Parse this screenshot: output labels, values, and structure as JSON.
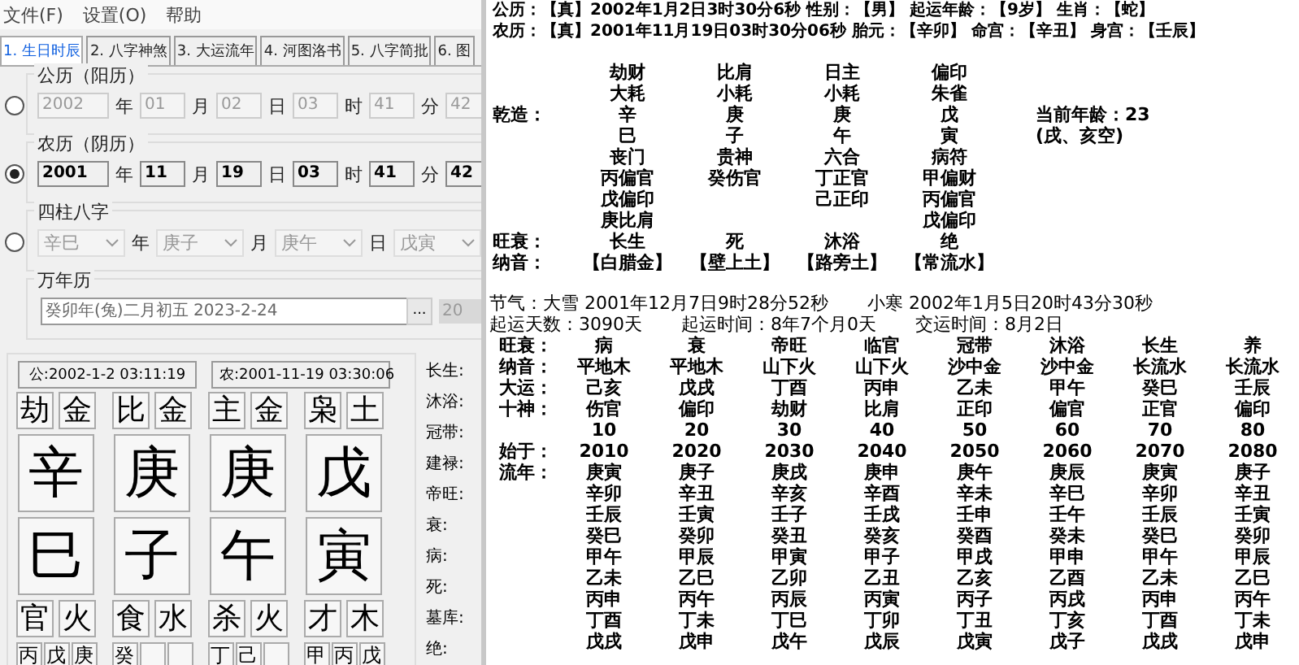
{
  "menu": [
    "文件(F)",
    "设置(O)",
    "帮助"
  ],
  "tabs": [
    {
      "label": "1. 生日时辰",
      "selected": true
    },
    {
      "label": "2. 八字神煞",
      "selected": false
    },
    {
      "label": "3. 大运流年",
      "selected": false
    },
    {
      "label": "4. 河图洛书",
      "selected": false
    },
    {
      "label": "5. 八字简批",
      "selected": false
    },
    {
      "label": "6. 图",
      "selected": false
    }
  ],
  "date_groups": [
    {
      "kind": "fields",
      "title": "公历（阳历）",
      "selected": false,
      "fields": [
        {
          "value": "2002",
          "unit": "年"
        },
        {
          "value": "01",
          "unit": "月"
        },
        {
          "value": "02",
          "unit": "日"
        },
        {
          "value": "03",
          "unit": "时"
        },
        {
          "value": "41",
          "unit": "分"
        },
        {
          "value": "42"
        }
      ]
    },
    {
      "kind": "fields",
      "title": "农历（阴历）",
      "selected": true,
      "fields": [
        {
          "value": "2001",
          "unit": "年"
        },
        {
          "value": "11",
          "unit": "月"
        },
        {
          "value": "19",
          "unit": "日"
        },
        {
          "value": "03",
          "unit": "时"
        },
        {
          "value": "41",
          "unit": "分"
        },
        {
          "value": "42"
        }
      ]
    },
    {
      "kind": "combos",
      "title": "四柱八字",
      "selected": false,
      "fields": [
        {
          "value": "辛巳",
          "unit": "年"
        },
        {
          "value": "庚子",
          "unit": "月"
        },
        {
          "value": "庚午",
          "unit": "日"
        },
        {
          "value": "戊寅"
        }
      ]
    }
  ],
  "calendar": {
    "title": "万年历",
    "value": "癸卯年(兔)二月初五  2023-2-24",
    "button": "...",
    "combo": "20"
  },
  "chart_card": {
    "solar_time": "公:2002-1-2 03:11:19",
    "lunar_time": "农:2001-11-19 03:30:06",
    "pillars": [
      {
        "top": [
          "劫",
          "金"
        ],
        "stem": "辛",
        "branch": "巳",
        "bottom": [
          "官",
          "火"
        ],
        "hidden": [
          "丙",
          "戊",
          "庚"
        ]
      },
      {
        "top": [
          "比",
          "金"
        ],
        "stem": "庚",
        "branch": "子",
        "bottom": [
          "食",
          "水"
        ],
        "hidden": [
          "癸"
        ]
      },
      {
        "top": [
          "主",
          "金"
        ],
        "stem": "庚",
        "branch": "午",
        "bottom": [
          "杀",
          "火"
        ],
        "hidden": [
          "丁",
          "己"
        ]
      },
      {
        "top": [
          "枭",
          "土"
        ],
        "stem": "戊",
        "branch": "寅",
        "bottom": [
          "才",
          "木"
        ],
        "hidden": [
          "甲",
          "丙",
          "戊"
        ]
      }
    ],
    "stages": [
      "长生:",
      "沐浴:",
      "冠带:",
      "建禄:",
      "帝旺:",
      "衰:",
      "病:",
      "死:",
      "墓库:",
      "绝:"
    ]
  },
  "report": {
    "header": [
      "公历：【真】2002年1月2日3时30分6秒  性别：【男】  起运年龄：【9岁】  生肖：【蛇】",
      "农历：【真】2001年11月19日03时30分06秒  胎元：【辛卯】  命宫：【辛丑】  身宫：【壬辰】"
    ],
    "chart_rows": [
      {
        "cells": [
          "劫财",
          "比肩",
          "日主",
          "偏印"
        ]
      },
      {
        "cells": [
          "大耗",
          "小耗",
          "小耗",
          "朱雀"
        ]
      },
      {
        "label": "乾造：",
        "cells": [
          "辛",
          "庚",
          "庚",
          "戊"
        ],
        "note": "当前年龄：23"
      },
      {
        "cells": [
          "巳",
          "子",
          "午",
          "寅"
        ],
        "note": "(戌、亥空)"
      },
      {
        "cells": [
          "丧门",
          "贵神",
          "六合",
          "病符"
        ]
      },
      {
        "cells": [
          "丙偏官",
          "癸伤官",
          "丁正官",
          "甲偏财"
        ]
      },
      {
        "cells": [
          "戊偏印",
          null,
          "己正印",
          "丙偏官"
        ]
      },
      {
        "cells": [
          "庚比肩",
          null,
          null,
          "戊偏印"
        ]
      },
      {
        "label": "旺衰：",
        "cells": [
          "长生",
          "死",
          "沐浴",
          "绝"
        ]
      },
      {
        "label": "纳音：",
        "cells": [
          "【白腊金】",
          "【壁上土】",
          "【路旁土】",
          "【常流水】"
        ]
      }
    ],
    "solar_terms": [
      "节气：大雪  2001年12月7日9时28分52秒",
      "小寒  2002年1月5日20时43分30秒"
    ],
    "luck_start": [
      "起运天数：3090天",
      "起运时间：8年7个月0天",
      "交运时间：8月2日"
    ],
    "luck_rows": [
      {
        "label": "旺衰：",
        "cells": [
          "病",
          "衰",
          "帝旺",
          "临官",
          "冠带",
          "沐浴",
          "长生",
          "养"
        ]
      },
      {
        "label": "纳音：",
        "cells": [
          "平地木",
          "平地木",
          "山下火",
          "山下火",
          "沙中金",
          "沙中金",
          "长流水",
          "长流水"
        ]
      },
      {
        "label": "大运：",
        "cells": [
          "己亥",
          "戊戌",
          "丁酉",
          "丙申",
          "乙未",
          "甲午",
          "癸巳",
          "壬辰"
        ]
      },
      {
        "label": "十神：",
        "cells": [
          "伤官",
          "偏印",
          "劫财",
          "比肩",
          "正印",
          "偏官",
          "正官",
          "偏印"
        ]
      },
      {
        "cells": [
          "10",
          "20",
          "30",
          "40",
          "50",
          "60",
          "70",
          "80"
        ]
      },
      {
        "label": "始于：",
        "cells": [
          "2010",
          "2020",
          "2030",
          "2040",
          "2050",
          "2060",
          "2070",
          "2080"
        ]
      },
      {
        "label": "流年：",
        "cells": [
          "庚寅",
          "庚子",
          "庚戌",
          "庚申",
          "庚午",
          "庚辰",
          "庚寅",
          "庚子"
        ]
      },
      {
        "cells": [
          "辛卯",
          "辛丑",
          "辛亥",
          "辛酉",
          "辛未",
          "辛巳",
          "辛卯",
          "辛丑"
        ]
      },
      {
        "cells": [
          "壬辰",
          "壬寅",
          "壬子",
          "壬戌",
          "壬申",
          "壬午",
          "壬辰",
          "壬寅"
        ]
      },
      {
        "cells": [
          "癸巳",
          "癸卯",
          "癸丑",
          "癸亥",
          "癸酉",
          "癸未",
          "癸巳",
          "癸卯"
        ]
      },
      {
        "cells": [
          "甲午",
          "甲辰",
          "甲寅",
          "甲子",
          "甲戌",
          "甲申",
          "甲午",
          "甲辰"
        ]
      },
      {
        "cells": [
          "乙未",
          "乙巳",
          "乙卯",
          "乙丑",
          "乙亥",
          "乙酉",
          "乙未",
          "乙巳"
        ]
      },
      {
        "cells": [
          "丙申",
          "丙午",
          "丙辰",
          "丙寅",
          "丙子",
          "丙戌",
          "丙申",
          "丙午"
        ]
      },
      {
        "cells": [
          "丁酉",
          "丁未",
          "丁巳",
          "丁卯",
          "丁丑",
          "丁亥",
          "丁酉",
          "丁未"
        ]
      },
      {
        "cells": [
          "戊戌",
          "戊申",
          "戊午",
          "戊辰",
          "戊寅",
          "戊子",
          "戊戌",
          "戊申"
        ]
      }
    ]
  }
}
